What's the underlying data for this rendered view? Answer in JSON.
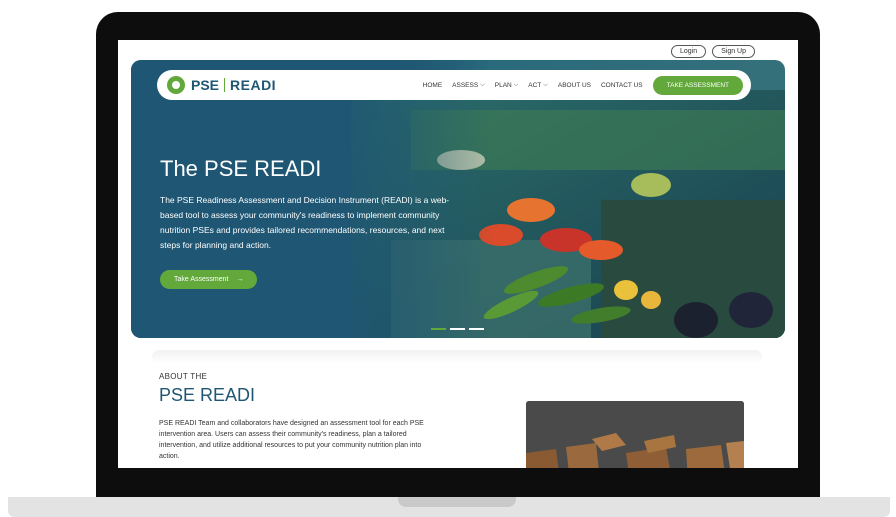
{
  "auth": {
    "login": "Login",
    "signup": "Sign Up"
  },
  "logo": {
    "left": "PSE",
    "right": "READI"
  },
  "nav": {
    "home": "HOME",
    "assess": "ASSESS",
    "plan": "PLAN",
    "act": "ACT",
    "about": "ABOUT US",
    "contact": "CONTACT US",
    "cta": "TAKE ASSESSMENT",
    "chevron": "⌵"
  },
  "hero": {
    "title": "The PSE READI",
    "description": "The PSE Readiness Assessment and Decision Instrument (READI) is a web-based tool to assess your community's readiness to implement community nutrition PSEs and provides tailored recommendations, resources, and next steps for planning and action.",
    "button": "Take Assessment",
    "button_arrow": "→",
    "active_slide": 1,
    "slide_count": 3
  },
  "about": {
    "kicker": "ABOUT THE",
    "title": "PSE READI",
    "body": "PSE READI Team and collaborators have designed an assessment tool for each PSE intervention area. Users can assess their community's readiness, plan a tailored intervention, and utilize additional resources to put your community nutrition plan into action."
  },
  "colors": {
    "brand_blue": "#1f5673",
    "brand_green": "#62a83a",
    "corner_dot_green": "#7bbf44",
    "corner_dot_red": "#e34b3f",
    "corner_dot_blue": "#1f5673"
  },
  "icons": {
    "logo": "apple-logo-icon",
    "chevron": "chevron-down-icon",
    "arrow": "arrow-right-icon"
  }
}
